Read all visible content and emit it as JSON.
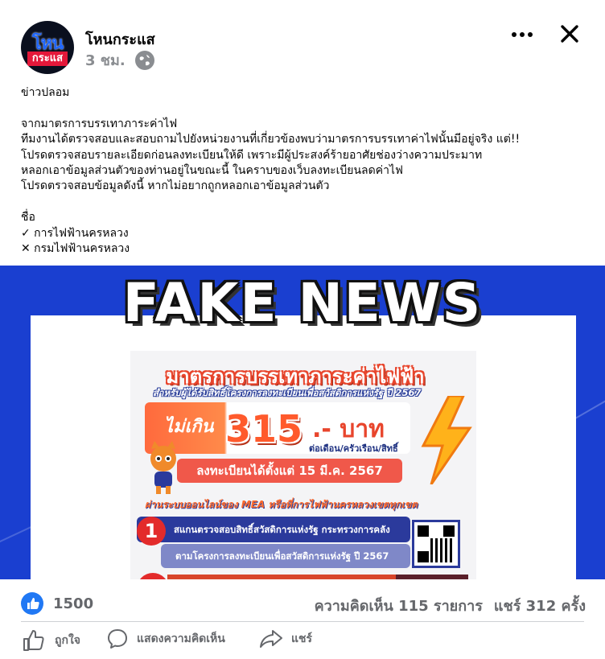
{
  "post": {
    "page_name": "โหนกระแส",
    "time": "3 ชม.",
    "avatar": {
      "text_top": "โหน",
      "text_bottom": "กระแส"
    },
    "body_lines": [
      "ข่าวปลอม",
      "",
      "จากมาตรการบรรเทาภาระค่าไฟ",
      "ทีมงานได้ตรวจสอบและสอบถามไปยังหน่วยงานที่เกี่ยวข้องพบว่ามาตรการบรรเทาค่าไฟนั้นมีอยู่จริง แต่!!",
      "โปรดตรวจสอบรายละเอียดก่อนลงทะเบียนให้ดี เพราะมีผู้ประสงค์ร้ายอาศัยช่องว่างความประมาท",
      "หลอกเอาข้อมูลส่วนตัวของท่านอยู่ในขณะนี้ ในคราบของเว็บลงทะเบียนลดค่าไฟ",
      "โปรดตรวจสอบข้อมูลดังนี้ หากไม่อยากถูกหลอกเอาข้อมูลส่วนตัว",
      "",
      "ชื่อ",
      "✓ การไฟฟ้านครหลวง",
      "✕ กรมไฟฟ้านครหลวง"
    ]
  },
  "image": {
    "headline": "FAKE NEWS",
    "poster": {
      "title": "มาตรการบรรเทาภาระค่าไฟฟ้า",
      "subtitle": "สำหรับผู้ได้รับสิทธิ์โครงการลงทะเบียนเพื่อสวัสดิการแห่งรัฐ ปี 2567",
      "not_over": "ไม่เกิน",
      "price": "315",
      "baht": ".- บาท",
      "per": "ต่อเดือน/ครัวเรือน/สิทธิ์",
      "register_from": "ลงทะเบียนได้ตั้งแต่ 15 มี.ค. 2567",
      "channel": "ผ่านระบบออนไลน์ของ MEA หรือที่การไฟฟ้านครหลวงเขตทุกเขต",
      "step1_number": "1",
      "step1_text": "สแกนตรวจสอบสิทธิ์สวัสดิการแห่งรัฐ กระทรวงการคลัง",
      "step1_sub": "ตามโครงการลงทะเบียนเพื่อสวัสดิการแห่งรัฐ ปี 2567"
    }
  },
  "stats": {
    "likes": "1500",
    "comments": "ความคิดเห็น 115 รายการ",
    "shares": "แชร์ 312 ครั้ง"
  },
  "actions": {
    "like": "ถูกใจ",
    "comment": "แสดงความคิดเห็น",
    "share": "แชร์"
  },
  "icons": {
    "more": "more-options-icon",
    "close": "close-icon",
    "privacy": "globe-icon",
    "like": "thumbs-up-icon",
    "comment": "comment-icon",
    "share": "share-icon"
  },
  "colors": {
    "facebook_blue": "#2078f4",
    "image_background": "#1a3fd0",
    "muted_text": "#65676b"
  }
}
